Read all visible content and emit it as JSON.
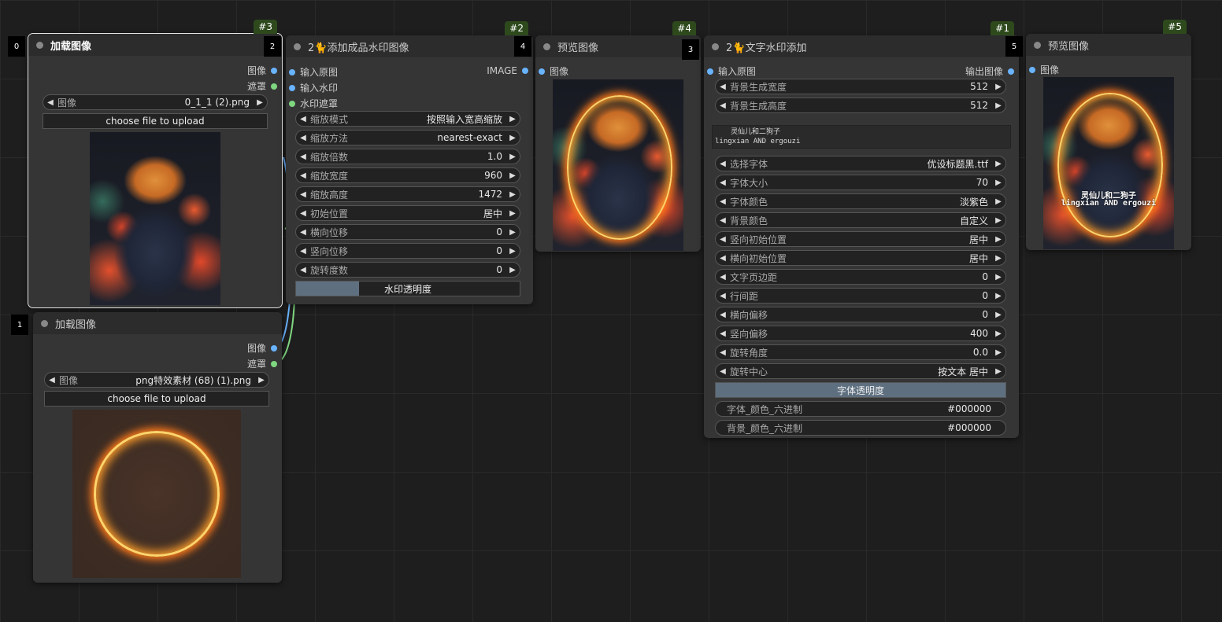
{
  "nodes": {
    "load1": {
      "badge": "#3",
      "order": "0",
      "title": "加载图像",
      "outputs": [
        "图像",
        "遮罩"
      ],
      "image_widget": {
        "label": "图像",
        "value": "0_1_1 (2).png"
      },
      "upload_label": "choose file to upload"
    },
    "load2": {
      "order": "1",
      "title": "加载图像",
      "outputs": [
        "图像",
        "遮罩"
      ],
      "image_widget": {
        "label": "图像",
        "value": "png特效素材 (68) (1).png"
      },
      "upload_label": "choose file to upload"
    },
    "watermark_img": {
      "badge": "#2",
      "order_left": "2",
      "order_right": "4",
      "title": "2🐈添加成品水印图像",
      "inputs": [
        "输入原图",
        "输入水印",
        "水印遮罩"
      ],
      "output": "IMAGE",
      "widgets": [
        {
          "label": "缩放模式",
          "value": "按照输入宽高缩放"
        },
        {
          "label": "缩放方法",
          "value": "nearest-exact"
        },
        {
          "label": "缩放倍数",
          "value": "1.0"
        },
        {
          "label": "缩放宽度",
          "value": "960"
        },
        {
          "label": "缩放高度",
          "value": "1472"
        },
        {
          "label": "初始位置",
          "value": "居中"
        },
        {
          "label": "横向位移",
          "value": "0"
        },
        {
          "label": "竖向位移",
          "value": "0"
        },
        {
          "label": "旋转度数",
          "value": "0"
        }
      ],
      "slider_label": "水印透明度",
      "slider_fraction": 0.28
    },
    "preview1": {
      "badge": "#4",
      "order": "3",
      "title": "预览图像",
      "input": "图像"
    },
    "text_watermark": {
      "badge": "#1",
      "order": "5",
      "title": "2🐈文字水印添加",
      "input": "输入原图",
      "output": "输出图像",
      "widgets_top": [
        {
          "label": "背景生成宽度",
          "value": "512"
        },
        {
          "label": "背景生成高度",
          "value": "512"
        }
      ],
      "text_lines": [
        "灵仙儿和二狗子",
        "lingxian AND ergouzi"
      ],
      "widgets": [
        {
          "label": "选择字体",
          "value": "优设标题黑.ttf"
        },
        {
          "label": "字体大小",
          "value": "70"
        },
        {
          "label": "字体颜色",
          "value": "淡紫色"
        },
        {
          "label": "背景颜色",
          "value": "自定义"
        },
        {
          "label": "竖向初始位置",
          "value": "居中"
        },
        {
          "label": "横向初始位置",
          "value": "居中"
        },
        {
          "label": "文字页边距",
          "value": "0"
        },
        {
          "label": "行间距",
          "value": "0"
        },
        {
          "label": "横向偏移",
          "value": "0"
        },
        {
          "label": "竖向偏移",
          "value": "400"
        },
        {
          "label": "旋转角度",
          "value": "0.0"
        },
        {
          "label": "旋转中心",
          "value": "按文本 居中"
        }
      ],
      "slider_label": "字体透明度",
      "slider_fraction": 1.0,
      "text_widgets": [
        {
          "label": "字体_颜色_六进制",
          "value": "#000000"
        },
        {
          "label": "背景_颜色_六进制",
          "value": "#000000"
        }
      ]
    },
    "preview2": {
      "badge": "#5",
      "title": "预览图像",
      "input": "图像",
      "overlay_lines": [
        "灵仙儿和二狗子",
        "lingxian AND ergouzi"
      ]
    }
  },
  "colors": {
    "badge": "#2e4a1d",
    "image_socket": "#69b3ff",
    "mask_socket": "#7fd680"
  }
}
